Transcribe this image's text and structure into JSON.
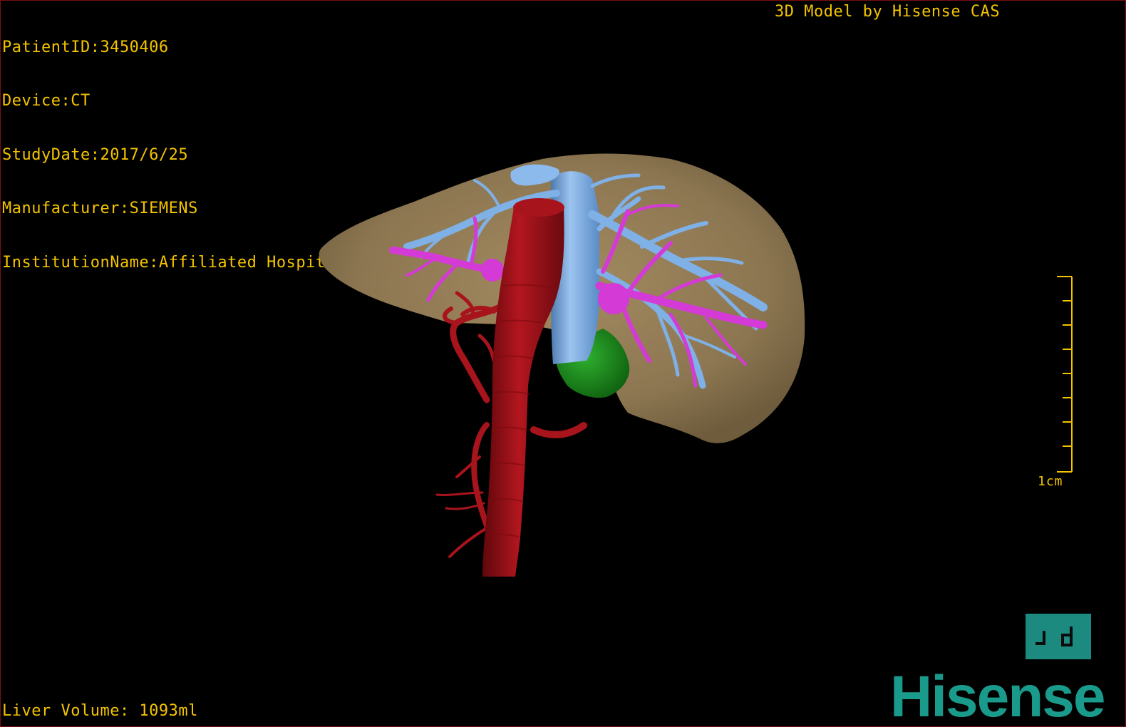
{
  "dicom_info": {
    "patient_id": "PatientID:3450406",
    "device": "Device:CT",
    "study_date": "StudyDate:2017/6/25",
    "manufacturer": "Manufacturer:SIEMENS",
    "institution": "InstitutionName:Affiliated Hospital Qingdao University-C"
  },
  "model_credit": "3D Model by Hisense CAS",
  "liver_volume": "Liver Volume: 1093ml",
  "scale": {
    "label": "1cm",
    "ticks": 8
  },
  "brand": "Hisense",
  "colors": {
    "overlay_text": "#f5c400",
    "liver": "#8c7651",
    "aorta": "#a8141c",
    "vena_cava": "#7fb0e6",
    "portal_vein": "#d43ad6",
    "gallbladder": "#1e8c1e",
    "brand": "#1a9a8a"
  },
  "model_structures": [
    "liver",
    "aorta",
    "inferior-vena-cava",
    "hepatic-veins",
    "portal-veins",
    "gallbladder",
    "hepatic-artery"
  ]
}
